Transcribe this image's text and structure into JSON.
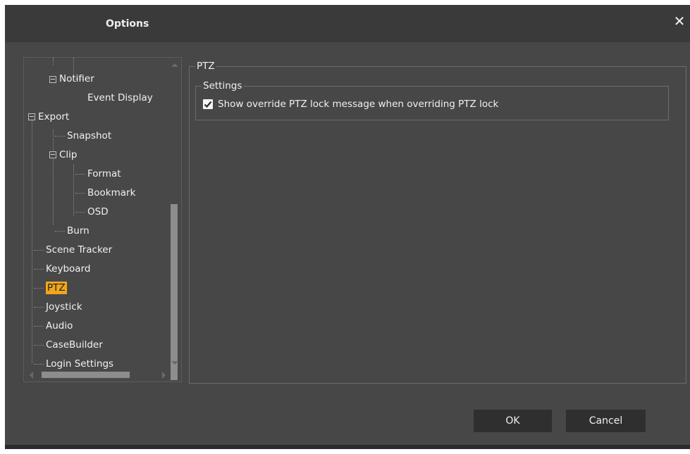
{
  "window": {
    "title": "Options",
    "close_symbol": "✕"
  },
  "tree": {
    "items": [
      {
        "label": "Notifier",
        "selected": false
      },
      {
        "label": "Event Display",
        "selected": false
      },
      {
        "label": "Export",
        "selected": false
      },
      {
        "label": "Snapshot",
        "selected": false
      },
      {
        "label": "Clip",
        "selected": false
      },
      {
        "label": "Format",
        "selected": false
      },
      {
        "label": "Bookmark",
        "selected": false
      },
      {
        "label": "OSD",
        "selected": false
      },
      {
        "label": "Burn",
        "selected": false
      },
      {
        "label": "Scene Tracker",
        "selected": false
      },
      {
        "label": "Keyboard",
        "selected": false
      },
      {
        "label": "PTZ",
        "selected": true
      },
      {
        "label": "Joystick",
        "selected": false
      },
      {
        "label": "Audio",
        "selected": false
      },
      {
        "label": "CaseBuilder",
        "selected": false
      },
      {
        "label": "Login Settings",
        "selected": false
      }
    ]
  },
  "content": {
    "group_title": "PTZ",
    "settings_title": "Settings",
    "checkbox_label": "Show override PTZ lock message when overriding PTZ lock",
    "checkbox_checked": true
  },
  "buttons": {
    "ok": "OK",
    "cancel": "Cancel"
  },
  "colors": {
    "selection": "#f2a51b",
    "background": "#474747",
    "button": "#2f2f2f"
  }
}
